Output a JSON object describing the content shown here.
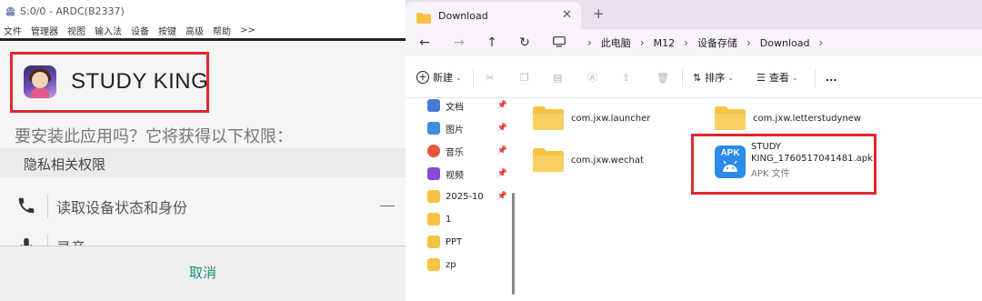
{
  "left": {
    "title": "S:0/0 - ARDC(B2337)",
    "menu": [
      "文件",
      "管理器",
      "视图",
      "输入法",
      "设备",
      "按键",
      "高级",
      "帮助",
      ">>"
    ],
    "app_name": "STUDY KING",
    "question": "要安装此应用吗？它将获得以下权限：",
    "section_label": "隐私相关权限",
    "permissions": [
      {
        "label": "读取设备状态和身份",
        "icon": "phone-icon"
      },
      {
        "label": "录音",
        "icon": "microphone-icon"
      }
    ],
    "cancel_label": "取消",
    "accent_color": "#1b8a7a",
    "highlight_color": "#e0282e"
  },
  "explorer": {
    "tab_title": "Download",
    "breadcrumbs": [
      "此电脑",
      "M12",
      "设备存储",
      "Download"
    ],
    "toolbar": {
      "new_label": "新建",
      "sort_label": "排序",
      "view_label": "查看",
      "more_label": "..."
    },
    "sidebar": [
      {
        "label": "文档",
        "icon": "document-icon",
        "pinned": true
      },
      {
        "label": "图片",
        "icon": "picture-icon",
        "pinned": true
      },
      {
        "label": "音乐",
        "icon": "music-icon",
        "pinned": true
      },
      {
        "label": "视频",
        "icon": "video-icon",
        "pinned": true
      },
      {
        "label": "2025-10",
        "icon": "folder-icon",
        "pinned": true
      },
      {
        "label": "1",
        "icon": "folder-icon",
        "pinned": false
      },
      {
        "label": "PPT",
        "icon": "folder-icon",
        "pinned": false
      },
      {
        "label": "zp",
        "icon": "folder-icon",
        "pinned": false
      }
    ],
    "folders": [
      "com.jxw.launcher",
      "com.jxw.letterstudynew",
      "com.jxw.wechat"
    ],
    "apk_file": {
      "icon_text": "APK",
      "name_line1": "STUDY",
      "name_line2": "KING_1760517041481.apk",
      "type": "APK 文件"
    }
  }
}
